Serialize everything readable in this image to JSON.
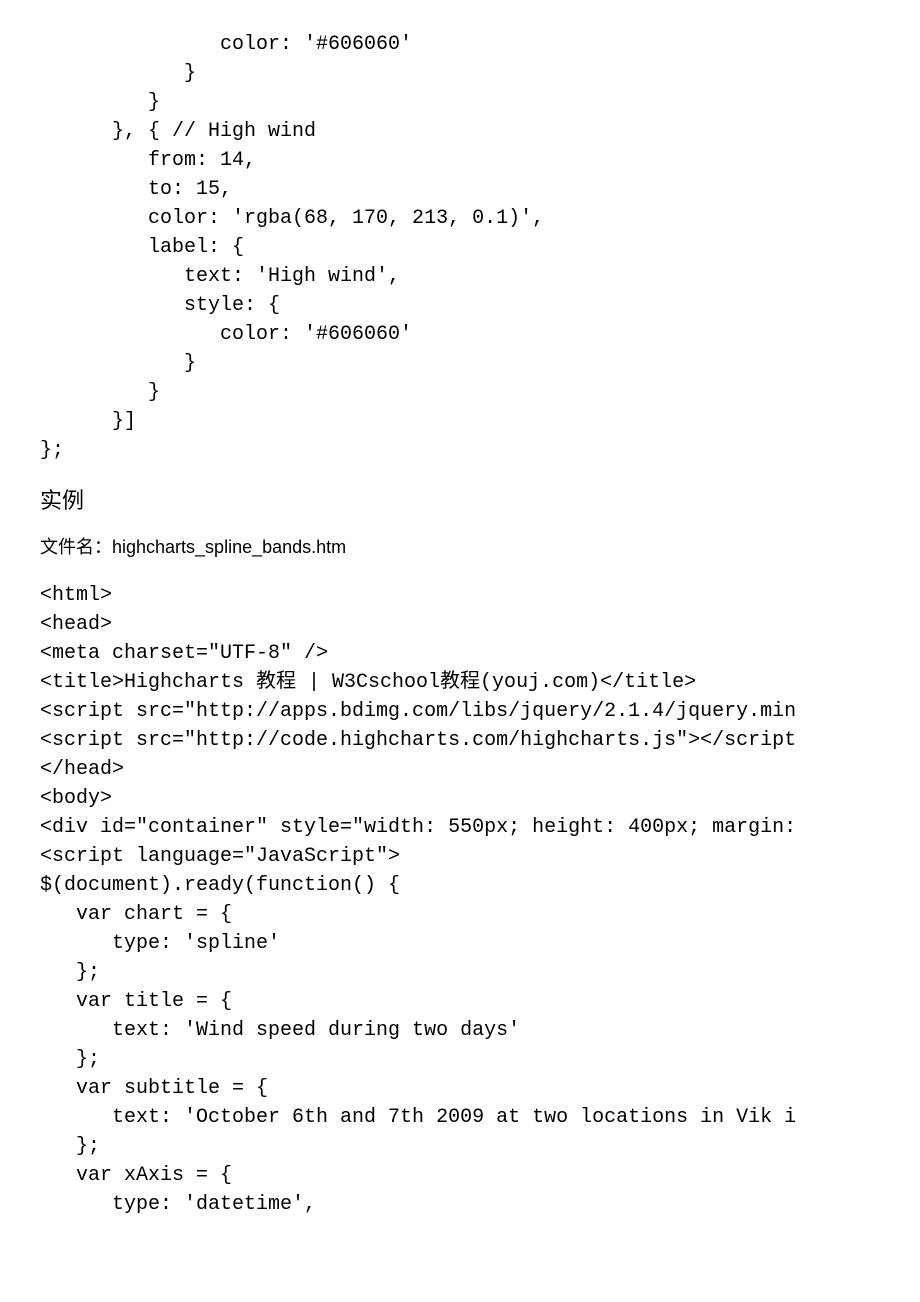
{
  "code_block_1": "               color: '#606060'\n            }\n         }\n      }, { // High wind\n         from: 14,\n         to: 15,\n         color: 'rgba(68, 170, 213, 0.1)',\n         label: {\n            text: 'High wind',\n            style: {\n               color: '#606060'\n            }\n         }\n      }]\n};",
  "heading": "实例",
  "filename_label": "文件名：",
  "filename_value": "highcharts_spline_bands.htm",
  "code_block_2": "<html>\n<head>\n<meta charset=\"UTF-8\" />\n<title>Highcharts 教程 | W3Cschool教程(youj.com)</title>\n<script src=\"http://apps.bdimg.com/libs/jquery/2.1.4/jquery.min\n<script src=\"http://code.highcharts.com/highcharts.js\"></script\n</head>\n<body>\n<div id=\"container\" style=\"width: 550px; height: 400px; margin:\n<script language=\"JavaScript\">\n$(document).ready(function() {\n   var chart = {\n      type: 'spline'\n   };\n   var title = {\n      text: 'Wind speed during two days'   \n   };    \n   var subtitle = {\n      text: 'October 6th and 7th 2009 at two locations in Vik i\n   };\n   var xAxis = {\n      type: 'datetime',"
}
